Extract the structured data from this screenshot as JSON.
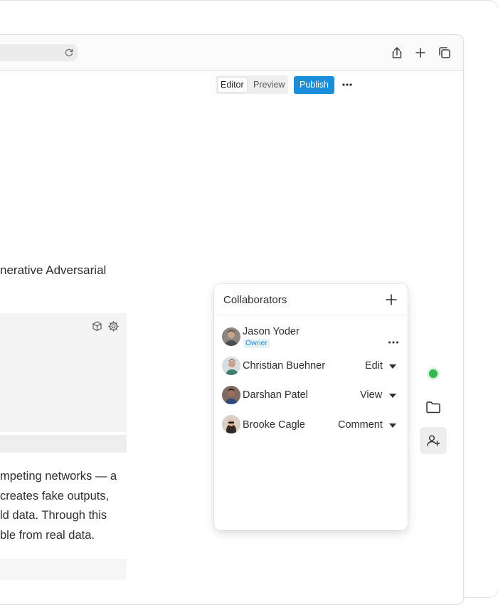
{
  "toolbar": {
    "editor_label": "Editor",
    "preview_label": "Preview",
    "publish_label": "Publish"
  },
  "content": {
    "heading_fragment": "nerative Adversarial",
    "paragraph_lines": [
      "mpeting networks — a",
      "creates fake outputs,",
      "ld data. Through this",
      "ble from real data."
    ]
  },
  "collaborators": {
    "title": "Collaborators",
    "owner_badge": "Owner",
    "people": [
      {
        "name": "Jason Yoder",
        "role": "Owner"
      },
      {
        "name": "Christian Buehner",
        "permission": "Edit"
      },
      {
        "name": "Darshan Patel",
        "permission": "View"
      },
      {
        "name": "Brooke Cagle",
        "permission": "Comment"
      }
    ]
  },
  "colors": {
    "accent": "#1a8ddb",
    "online": "#2fb84f"
  }
}
